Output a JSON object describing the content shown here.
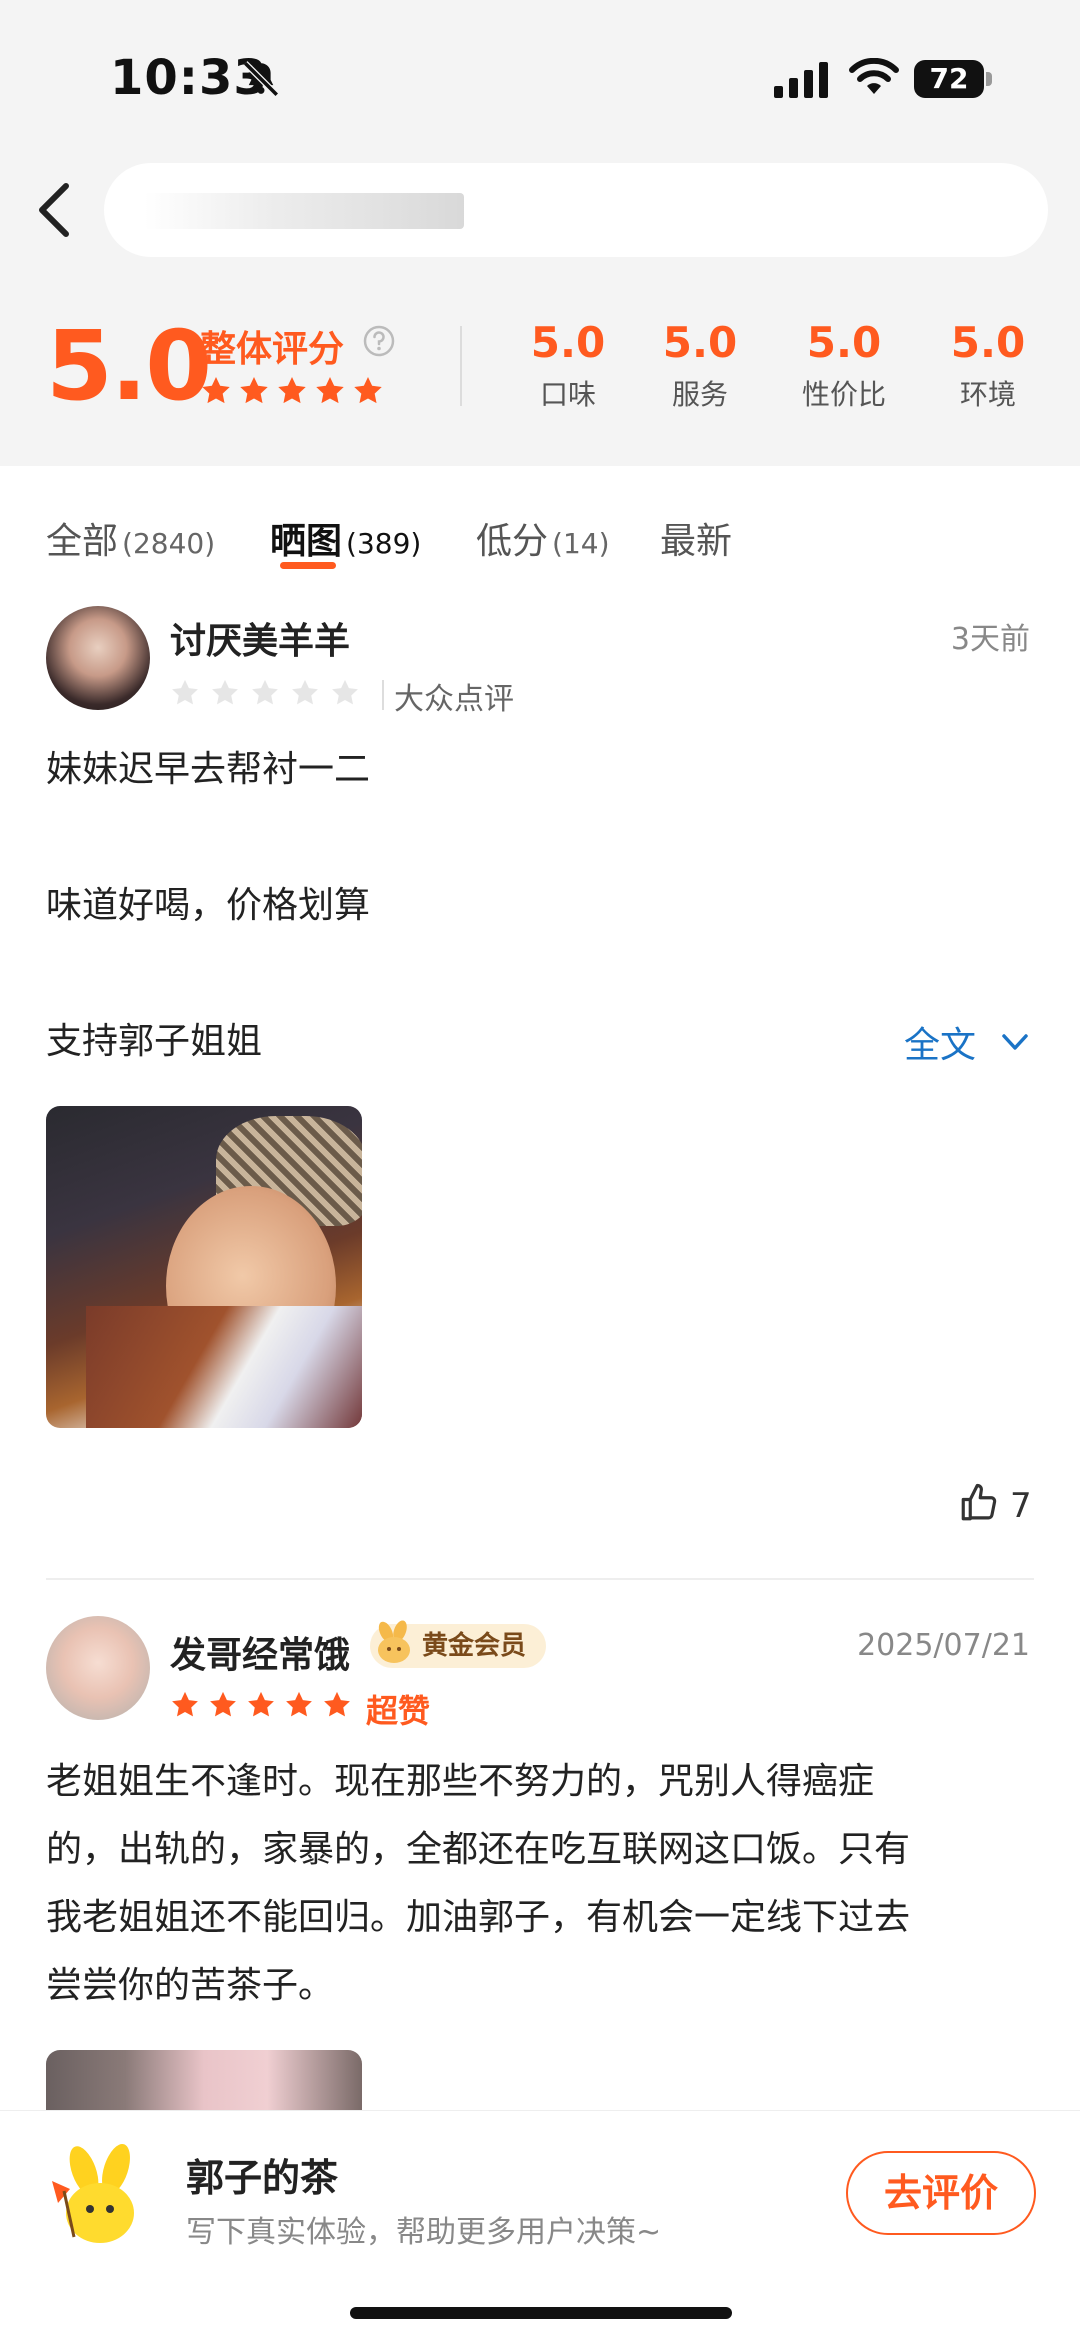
{
  "status_bar": {
    "time": "10:33",
    "battery": "72"
  },
  "rating": {
    "overall": "5.0",
    "overall_label": "整体评分",
    "sub_scores": [
      {
        "value": "5.0",
        "label": "口味"
      },
      {
        "value": "5.0",
        "label": "服务"
      },
      {
        "value": "5.0",
        "label": "性价比"
      },
      {
        "value": "5.0",
        "label": "环境"
      }
    ]
  },
  "tabs": [
    {
      "label": "全部",
      "count": "(2840)"
    },
    {
      "label": "晒图",
      "count": "(389)"
    },
    {
      "label": "低分",
      "count": "(14)"
    },
    {
      "label": "最新",
      "count": ""
    }
  ],
  "reviews": [
    {
      "user": "讨厌美羊羊",
      "time": "3天前",
      "source": "大众点评",
      "lines": [
        "妹妹迟早去帮衬一二",
        "味道好喝，价格划算",
        "支持郭子姐姐"
      ],
      "fulltext": "全文",
      "likes": "7"
    },
    {
      "user": "发哥经常饿",
      "badge": "黄金会员",
      "time": "2025/07/21",
      "praise": "超赞",
      "lines": [
        "老姐姐生不逢时。现在那些不努力的，咒别人得癌症",
        "的，出轨的，家暴的，全都还在吃互联网这口饭。只有",
        "我老姐姐还不能回归。加油郭子，有机会一定线下过去",
        "尝尝你的苦茶子。"
      ]
    }
  ],
  "bottom_bar": {
    "shop_name": "郭子的茶",
    "hint": "写下真实体验，帮助更多用户决策~",
    "button": "去评价"
  },
  "colors": {
    "accent": "#ff5a1f",
    "link": "#1a73c6"
  }
}
